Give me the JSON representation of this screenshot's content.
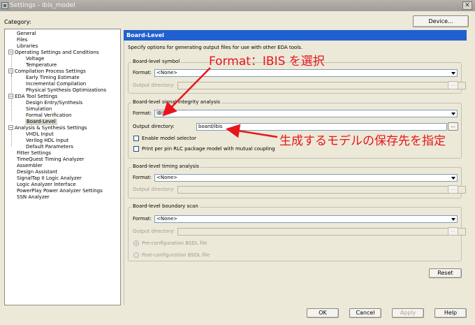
{
  "window": {
    "title": "Settings - ibis_model",
    "close_glyph": "✕"
  },
  "category_label": "Category:",
  "device_button": "Device...",
  "tree": [
    {
      "label": "General",
      "level": 0,
      "expander": ""
    },
    {
      "label": "Files",
      "level": 0,
      "expander": ""
    },
    {
      "label": "Libraries",
      "level": 0,
      "expander": ""
    },
    {
      "label": "Operating Settings and Conditions",
      "level": 0,
      "expander": "−"
    },
    {
      "label": "Voltage",
      "level": 1,
      "expander": ""
    },
    {
      "label": "Temperature",
      "level": 1,
      "expander": ""
    },
    {
      "label": "Compilation Process Settings",
      "level": 0,
      "expander": "−"
    },
    {
      "label": "Early Timing Estimate",
      "level": 1,
      "expander": ""
    },
    {
      "label": "Incremental Compilation",
      "level": 1,
      "expander": ""
    },
    {
      "label": "Physical Synthesis Optimizations",
      "level": 1,
      "expander": ""
    },
    {
      "label": "EDA Tool Settings",
      "level": 0,
      "expander": "−"
    },
    {
      "label": "Design Entry/Synthesis",
      "level": 1,
      "expander": ""
    },
    {
      "label": "Simulation",
      "level": 1,
      "expander": ""
    },
    {
      "label": "Formal Verification",
      "level": 1,
      "expander": ""
    },
    {
      "label": "Board-Level",
      "level": 1,
      "expander": "",
      "selected": true
    },
    {
      "label": "Analysis & Synthesis Settings",
      "level": 0,
      "expander": "−"
    },
    {
      "label": "VHDL Input",
      "level": 1,
      "expander": ""
    },
    {
      "label": "Verilog HDL Input",
      "level": 1,
      "expander": ""
    },
    {
      "label": "Default Parameters",
      "level": 1,
      "expander": ""
    },
    {
      "label": "Fitter Settings",
      "level": 0,
      "expander": ""
    },
    {
      "label": "TimeQuest Timing Analyzer",
      "level": 0,
      "expander": ""
    },
    {
      "label": "Assembler",
      "level": 0,
      "expander": ""
    },
    {
      "label": "Design Assistant",
      "level": 0,
      "expander": ""
    },
    {
      "label": "SignalTap II Logic Analyzer",
      "level": 0,
      "expander": ""
    },
    {
      "label": "Logic Analyzer Interface",
      "level": 0,
      "expander": ""
    },
    {
      "label": "PowerPlay Power Analyzer Settings",
      "level": 0,
      "expander": ""
    },
    {
      "label": "SSN Analyzer",
      "level": 0,
      "expander": ""
    }
  ],
  "panel": {
    "title": "Board-Level",
    "description": "Specify options for generating output files for use with other EDA tools.",
    "symbol": {
      "title": "Board-level symbol",
      "format_label": "Format:",
      "format_value": "<None>",
      "outdir_label": "Output directory:",
      "outdir_value": "",
      "browse": "..."
    },
    "signal": {
      "title": "Board-level signal integrity analysis",
      "format_label": "Format:",
      "format_value": "IBIS",
      "outdir_label": "Output directory:",
      "outdir_value": "board/ibis",
      "browse": "...",
      "enable_model_selector": "Enable model selector",
      "per_pin_rlc": "Print per pin RLC package model with mutual coupling"
    },
    "timing": {
      "title": "Board-level timing analysis",
      "format_label": "Format:",
      "format_value": "<None>",
      "outdir_label": "Output directory:",
      "outdir_value": "",
      "browse": "..."
    },
    "boundary": {
      "title": "Board-level boundary scan",
      "format_label": "Format:",
      "format_value": "<None>",
      "outdir_label": "Output directory:",
      "outdir_value": "",
      "browse": "...",
      "pre_config": "Pre-configuration BSDL file",
      "post_config": "Post-configuration BSDL file"
    },
    "reset": "Reset"
  },
  "buttons": {
    "ok": "OK",
    "cancel": "Cancel",
    "apply": "Apply",
    "help": "Help"
  },
  "annotations": {
    "format_note": "Format：IBIS を選択",
    "output_note": "生成するモデルの保存先を指定",
    "color": "#e8151b"
  },
  "colors": {
    "header_blue": "#2060d0",
    "dialog_bg": "#ece9d8"
  }
}
